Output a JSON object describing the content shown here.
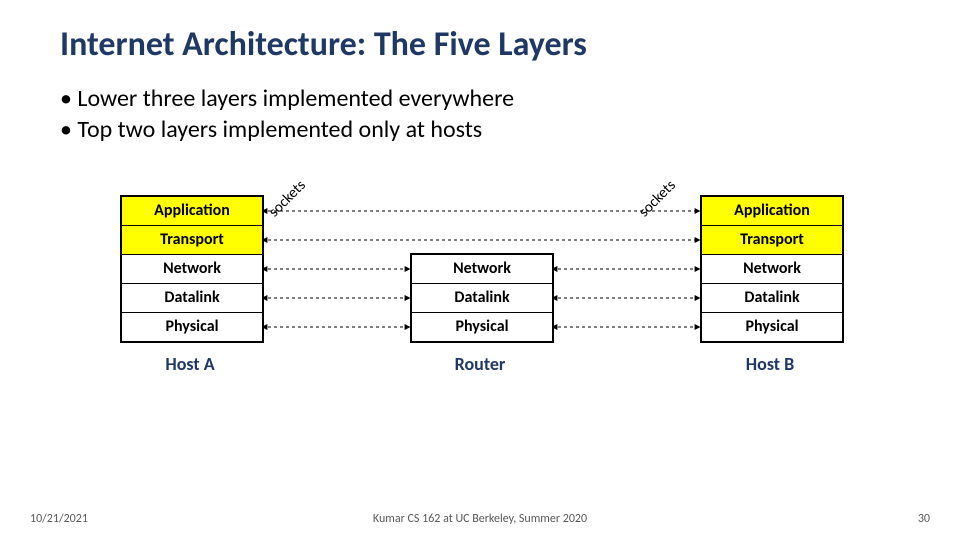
{
  "title": "Internet Architecture: The Five Layers",
  "bullets": [
    "Lower three layers implemented everywhere",
    "Top two layers implemented only at hosts"
  ],
  "hostA": {
    "label": "Host A",
    "layers": [
      "Application",
      "Transport",
      "Network",
      "Datalink",
      "Physical"
    ]
  },
  "router": {
    "label": "Router",
    "layers": [
      "Network",
      "Datalink",
      "Physical"
    ]
  },
  "hostB": {
    "label": "Host B",
    "layers": [
      "Application",
      "Transport",
      "Network",
      "Datalink",
      "Physical"
    ]
  },
  "socket_label_left": "sockets",
  "socket_label_right": "sockets",
  "footer": {
    "date": "10/21/2021",
    "center": "Kumar CS 162 at UC Berkeley, Summer 2020",
    "page": "30"
  },
  "chart_data": {
    "type": "table",
    "title": "Internet Architecture: The Five Layers",
    "nodes": [
      {
        "id": "hostA",
        "label": "Host A",
        "layers": [
          "Application",
          "Transport",
          "Network",
          "Datalink",
          "Physical"
        ]
      },
      {
        "id": "router",
        "label": "Router",
        "layers": [
          "Network",
          "Datalink",
          "Physical"
        ]
      },
      {
        "id": "hostB",
        "label": "Host B",
        "layers": [
          "Application",
          "Transport",
          "Network",
          "Datalink",
          "Physical"
        ]
      }
    ],
    "edges": [
      {
        "from": "hostA.Application",
        "to": "hostB.Application",
        "label": "sockets",
        "style": "dashed",
        "arrows": "both"
      },
      {
        "from": "hostA.Transport",
        "to": "hostB.Transport",
        "style": "dashed",
        "arrows": "both"
      },
      {
        "from": "hostA.Network",
        "to": "router.Network",
        "style": "dashed",
        "arrows": "both"
      },
      {
        "from": "hostA.Datalink",
        "to": "router.Datalink",
        "style": "dashed",
        "arrows": "both"
      },
      {
        "from": "hostA.Physical",
        "to": "router.Physical",
        "style": "dashed",
        "arrows": "both"
      },
      {
        "from": "router.Network",
        "to": "hostB.Network",
        "style": "dashed",
        "arrows": "both"
      },
      {
        "from": "router.Datalink",
        "to": "hostB.Datalink",
        "style": "dashed",
        "arrows": "both"
      },
      {
        "from": "router.Physical",
        "to": "hostB.Physical",
        "style": "dashed",
        "arrows": "both"
      }
    ]
  }
}
